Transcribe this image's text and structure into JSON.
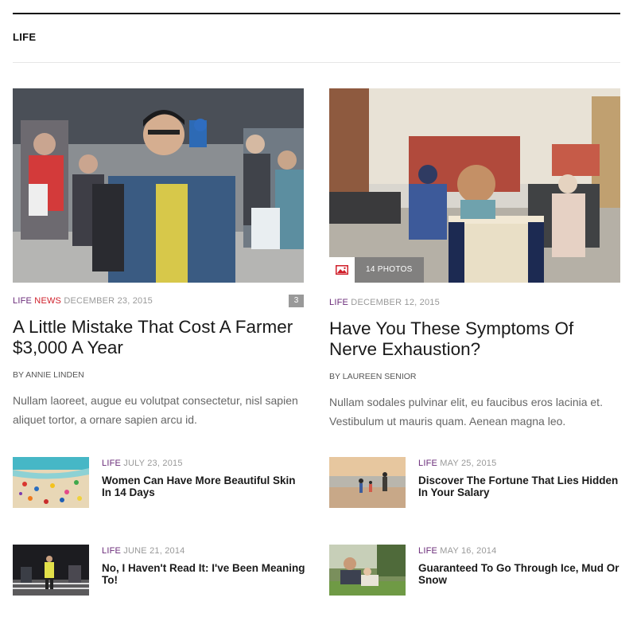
{
  "section": {
    "title": "LIFE"
  },
  "featured": [
    {
      "category": "LIFE",
      "category2": "NEWS",
      "date": "DECEMBER 23, 2015",
      "comments": "3",
      "title": "A Little Mistake That Cost A Farmer $3,000 A Year",
      "byline": "BY ANNIE LINDEN",
      "excerpt": "Nullam laoreet, augue eu volutpat consectetur, nisl sapien aliquet tortor, a ornare sapien arcu id."
    },
    {
      "category": "LIFE",
      "date": "DECEMBER 12, 2015",
      "photo_count": "14 PHOTOS",
      "title": "Have You These Symptoms Of Nerve Exhaustion?",
      "byline": "BY LAUREEN SENIOR",
      "excerpt": "Nullam sodales pulvinar elit, eu faucibus eros lacinia et. Vestibulum ut mauris quam. Aenean magna leo."
    }
  ],
  "small_posts": [
    {
      "category": "LIFE",
      "date": "JULY 23, 2015",
      "title": "Women Can Have More Beautiful Skin In 14 Days"
    },
    {
      "category": "LIFE",
      "date": "MAY 25, 2015",
      "title": "Discover The Fortune That Lies Hidden In Your Salary"
    },
    {
      "category": "LIFE",
      "date": "JUNE 21, 2014",
      "title": "No, I Haven't Read It: I've Been Meaning To!"
    },
    {
      "category": "LIFE",
      "date": "MAY 16, 2014",
      "title": "Guaranteed To Go Through Ice, Mud Or Snow"
    }
  ],
  "colors": {
    "category": "#6b2c7a",
    "category_news": "#d01f2a",
    "badge": "#999999"
  },
  "icons": {
    "photo": "image-icon"
  }
}
